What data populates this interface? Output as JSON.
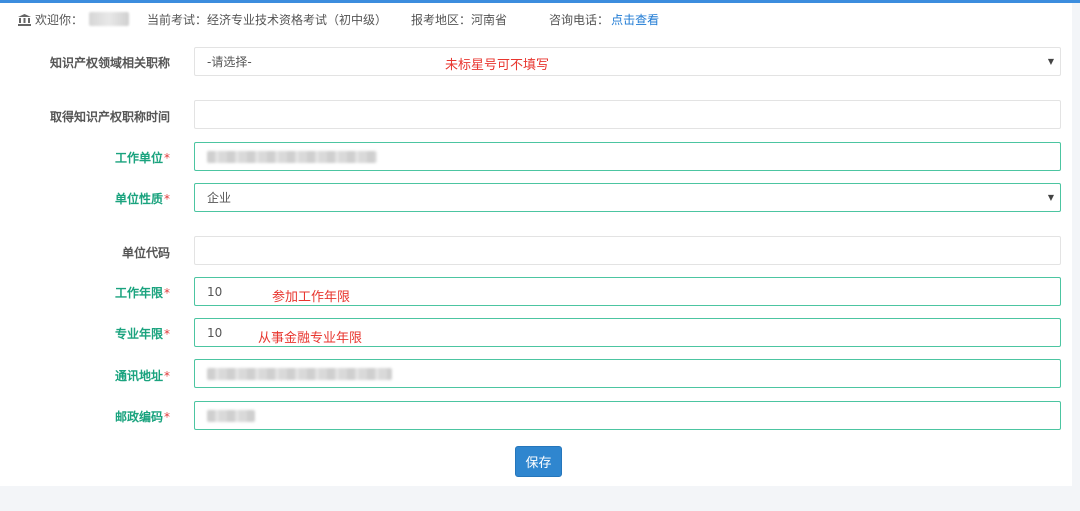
{
  "infobar": {
    "welcome_label": "欢迎你：",
    "exam_text": "当前考试：经济专业技术资格考试（初中级）",
    "region_text": "报考地区：河南省",
    "phone_label": "咨询电话：",
    "phone_link": "点击查看"
  },
  "form": {
    "ip_field": {
      "label": "知识产权领域相关职称",
      "value": "-请选择-",
      "note": "未标星号可不填写"
    },
    "ip_time": {
      "label": "取得知识产权职称时间",
      "value": ""
    },
    "work_unit": {
      "label": "工作单位",
      "star": "*"
    },
    "unit_nature": {
      "label": "单位性质",
      "star": "*",
      "value": "企业"
    },
    "unit_code": {
      "label": "单位代码",
      "value": ""
    },
    "work_years": {
      "label": "工作年限",
      "star": "*",
      "value": "10",
      "note": "参加工作年限"
    },
    "pro_years": {
      "label": "专业年限",
      "star": "*",
      "value": "10",
      "note": "从事金融专业年限"
    },
    "address": {
      "label": "通讯地址",
      "star": "*"
    },
    "postcode": {
      "label": "邮政编码",
      "star": "*"
    }
  },
  "save_label": "保存",
  "colors": {
    "accent": "#2f86cf",
    "required_label": "#1aa37e",
    "note_red": "#e8362f",
    "field_border_active": "#4cc5a1"
  }
}
